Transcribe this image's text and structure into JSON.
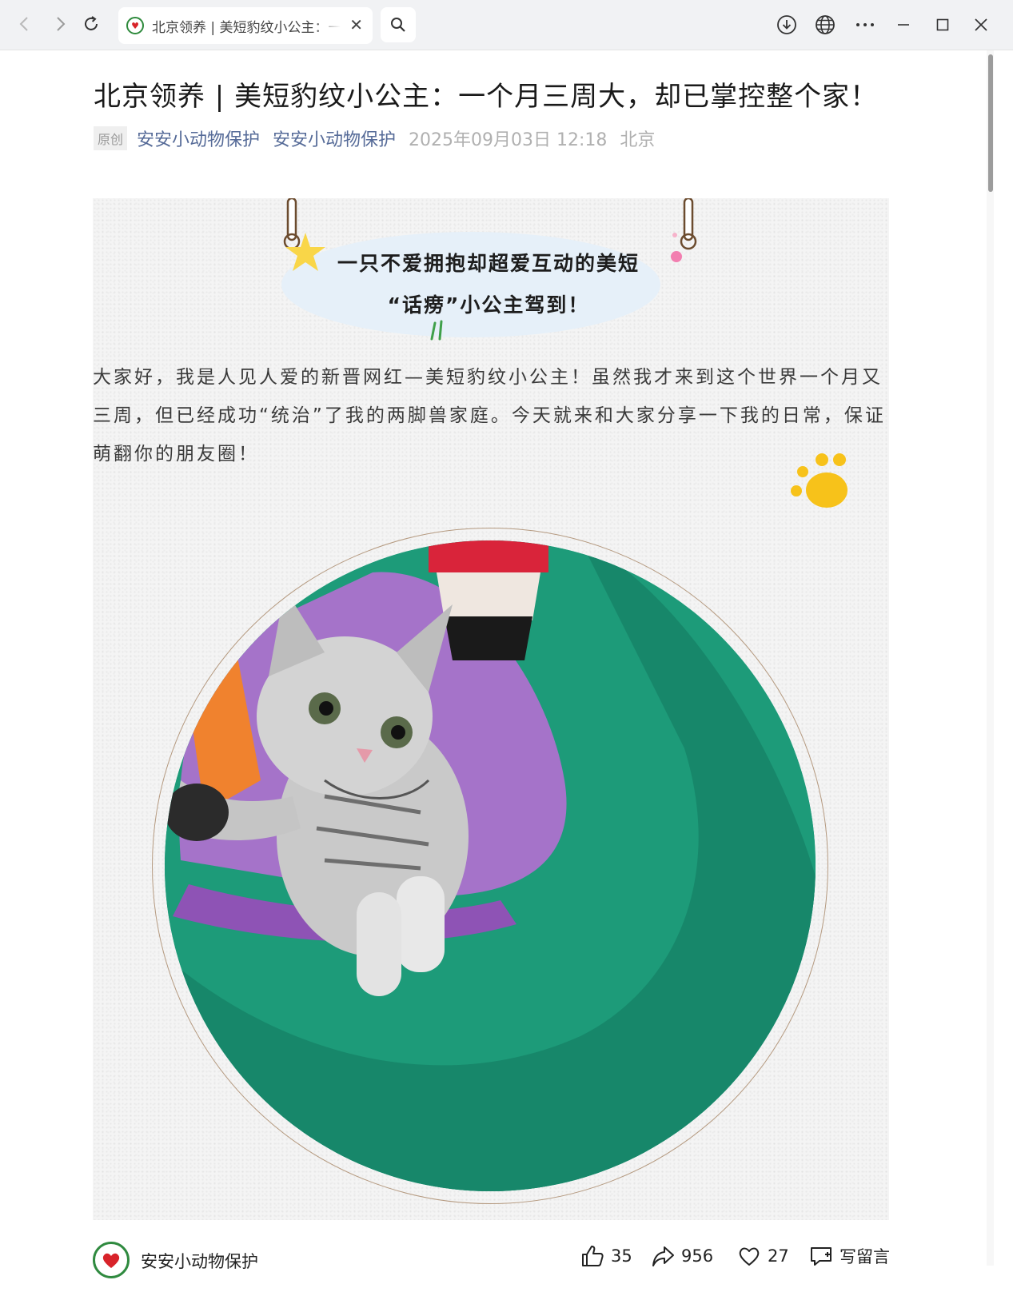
{
  "browser": {
    "tab_title": "北京领养 | 美短豹纹小公主：一个月三周大，却已掌控整个家！",
    "tab_close": "✕"
  },
  "article": {
    "title": "北京领养 | 美短豹纹小公主：一个月三周大，却已掌控整个家！",
    "badge": "原创",
    "author": "安安小动物保护",
    "account": "安安小动物保护",
    "date": "2025年09月03日 12:18",
    "location": "北京",
    "headline_line1": "一只不爱拥抱却超爱互动的美短",
    "headline_line2": "“话痨”小公主驾到！",
    "intro": "大家好，我是人见人爱的新晋网红—美短豹纹小公主！虽然我才来到这个世界一个月又三周，但已经成功“统治”了我的两脚兽家庭。今天就来和大家分享一下我的日常，保证萌翻你的朋友圈！"
  },
  "footer": {
    "account_name": "安安小动物保护",
    "likes": "35",
    "shares": "956",
    "favorites": "27",
    "comment_label": "写留言"
  },
  "colors": {
    "link": "#566b98",
    "cloud": "#e6f0f9",
    "paw": "#f7c21a",
    "favicon_ring": "#2e8a3c"
  },
  "icons": [
    "back-icon",
    "forward-icon",
    "reload-icon",
    "search-icon",
    "download-icon",
    "globe-icon",
    "more-icon",
    "minimize-icon",
    "maximize-icon",
    "close-icon",
    "thumbs-up-icon",
    "share-icon",
    "heart-icon",
    "comment-icon"
  ]
}
